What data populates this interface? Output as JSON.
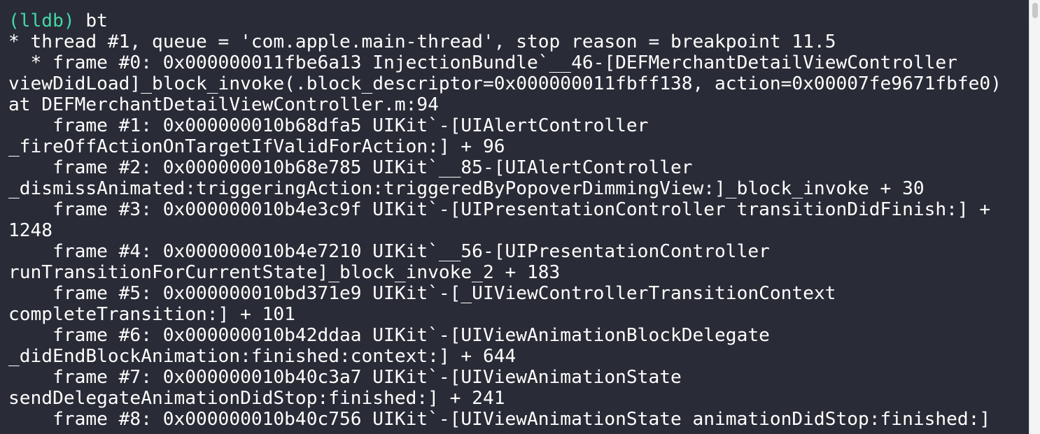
{
  "theme": {
    "background": "#292b36",
    "text": "#ffffff",
    "prompt": "#41d9a6"
  },
  "console": {
    "prompt": "(lldb)",
    "command": " bt",
    "lines": [
      "* thread #1, queue = 'com.apple.main-thread', stop reason = breakpoint 11.5",
      "  * frame #0: 0x000000011fbe6a13 InjectionBundle`__46-[DEFMerchantDetailViewController",
      "viewDidLoad]_block_invoke(.block_descriptor=0x000000011fbff138, action=0x00007fe9671fbfe0)",
      "at DEFMerchantDetailViewController.m:94",
      "    frame #1: 0x000000010b68dfa5 UIKit`-[UIAlertController",
      "_fireOffActionOnTargetIfValidForAction:] + 96",
      "    frame #2: 0x000000010b68e785 UIKit`__85-[UIAlertController",
      "_dismissAnimated:triggeringAction:triggeredByPopoverDimmingView:]_block_invoke + 30",
      "    frame #3: 0x000000010b4e3c9f UIKit`-[UIPresentationController transitionDidFinish:] +",
      "1248",
      "    frame #4: 0x000000010b4e7210 UIKit`__56-[UIPresentationController",
      "runTransitionForCurrentState]_block_invoke_2 + 183",
      "    frame #5: 0x000000010bd371e9 UIKit`-[_UIViewControllerTransitionContext",
      "completeTransition:] + 101",
      "    frame #6: 0x000000010b42ddaa UIKit`-[UIViewAnimationBlockDelegate",
      "_didEndBlockAnimation:finished:context:] + 644",
      "    frame #7: 0x000000010b40c3a7 UIKit`-[UIViewAnimationState",
      "sendDelegateAnimationDidStop:finished:] + 241",
      "    frame #8: 0x000000010b40c756 UIKit`-[UIViewAnimationState animationDidStop:finished:]"
    ]
  }
}
